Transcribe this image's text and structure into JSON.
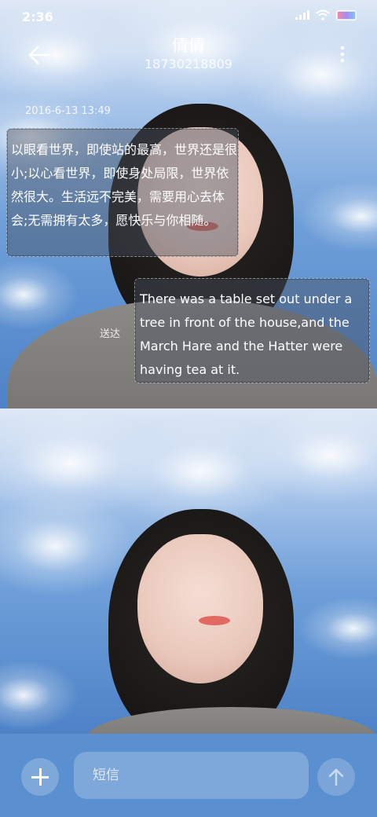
{
  "status_bar": {
    "time": "2:36",
    "signal_icon": "signal-icon",
    "wifi_icon": "wifi-icon",
    "battery_icon": "battery-icon"
  },
  "header": {
    "title": "倩倩",
    "phone": "18730218809",
    "back_icon": "back-arrow-icon",
    "more_icon": "more-vertical-icon"
  },
  "thread": {
    "date": "2016-6-13 13:49",
    "incoming_text": "以眼看世界，即使站的最高，世界还是很小;以心看世界，即使身处局限，世界依然很大。生活远不完美，需要用心去体会;无需拥有太多，愿快乐与你相随。",
    "outgoing_text": "There was a table set out under a tree in front of the house,and the March Hare and the Hatter were having tea at it.",
    "sent_status": "送达"
  },
  "composer": {
    "placeholder": "短信",
    "plus_icon": "plus-icon",
    "send_icon": "send-arrow-icon"
  },
  "colors": {
    "composer_bg": "#5a8fd0",
    "sky": "#6e9fd9"
  }
}
